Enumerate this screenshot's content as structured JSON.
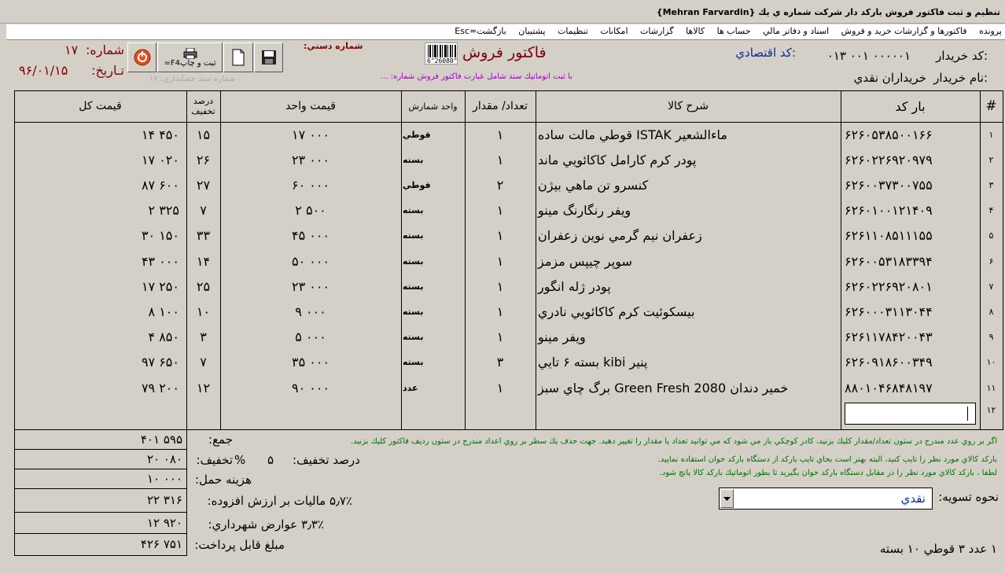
{
  "window": {
    "title": "تنظيم و ثبت فاكتور فروش باركد دار شركت شماره ي يك   {Mehran Farvardin}"
  },
  "menu": [
    "پرونده",
    "فاكتورها و گزارشات خريد و فروش",
    "اسناد و دفاتر مالي",
    "حساب ها",
    "كالاها",
    "گزارشات",
    "امكانات",
    "تنظيمات",
    "پشتيبان",
    "بازگشت=Esc"
  ],
  "header": {
    "buyer_code_label": "كد خريدار:",
    "buyer_code_value": "۰۱۳  ۰۰۱  ۰۰۰۰۰۱",
    "economic_code_label": "كد اقتصادي:",
    "buyer_name_label": "نام خريدار:",
    "buyer_name_value": "خريداران نقدي",
    "invoice_title": "فاكتور فروش",
    "barcode_digits": "6\"26080\"",
    "auto_note": "با ثبت اتوماتيك سند شامل عبارت فاكتور فروش شماره: ...",
    "manual_no_label": "شماره دستي:",
    "number_label": "شماره:",
    "number_value": "۱۷",
    "date_label": "تـاريخ:",
    "date_value": "۹۶/۰۱/۱۵",
    "doc_no_label": "شماره سند حسابداري: ۱۷"
  },
  "toolbar": {
    "print_label_1": "ثبت و چاپ",
    "print_label_2": "F4="
  },
  "icons": {
    "save": "floppy-disk-icon",
    "new": "new-document-icon",
    "print": "printer-icon",
    "exit": "power-icon"
  },
  "columns": {
    "idx": "#",
    "barcode": "بار كد",
    "desc": "شرح كالا",
    "qty": "تعداد/ مقدار",
    "unit": "واحد شمارش",
    "unit_price": "قيمت واحد",
    "disc_1": "درصد",
    "disc_2": "تخفيف",
    "total": "قيمت كل"
  },
  "rows": [
    {
      "n": "۱",
      "barcode": "۶۲۶۰۵۳۸۵۰۰۱۶۶",
      "desc": "ماءالشعير ISTAK قوطي مالت ساده",
      "qty": "۱",
      "unit": "قوطي",
      "price": "۱۷ ۰۰۰",
      "disc": "۱۵",
      "total": "۱۴ ۴۵۰"
    },
    {
      "n": "۲",
      "barcode": "۶۲۶۰۲۲۶۹۲۰۹۷۹",
      "desc": "پودر كرم كارامل كاكائويي ماند",
      "qty": "۱",
      "unit": "بسته",
      "price": "۲۳ ۰۰۰",
      "disc": "۲۶",
      "total": "۱۷ ۰۲۰"
    },
    {
      "n": "۳",
      "barcode": "۶۲۶۰۰۳۷۳۰۰۷۵۵",
      "desc": "كنسرو تن ماهي بيژن",
      "qty": "۲",
      "unit": "قوطي",
      "price": "۶۰ ۰۰۰",
      "disc": "۲۷",
      "total": "۸۷ ۶۰۰"
    },
    {
      "n": "۴",
      "barcode": "۶۲۶۰۱۰۰۱۲۱۴۰۹",
      "desc": "ويفر رنگارنگ مينو",
      "qty": "۱",
      "unit": "بسته",
      "price": "۲ ۵۰۰",
      "disc": "۷",
      "total": "۲ ۳۲۵"
    },
    {
      "n": "۵",
      "barcode": "۶۲۶۱۱۰۸۵۱۱۱۵۵",
      "desc": "زعفران نيم گرمي نوين زعفران",
      "qty": "۱",
      "unit": "بسته",
      "price": "۴۵ ۰۰۰",
      "disc": "۳۳",
      "total": "۳۰ ۱۵۰"
    },
    {
      "n": "۶",
      "barcode": "۶۲۶۰۰۵۳۱۸۳۳۹۴",
      "desc": "سوپر چيپس مزمز",
      "qty": "۱",
      "unit": "بسته",
      "price": "۵۰ ۰۰۰",
      "disc": "۱۴",
      "total": "۴۳ ۰۰۰"
    },
    {
      "n": "۷",
      "barcode": "۶۲۶۰۲۲۶۹۲۰۸۰۱",
      "desc": "پودر ژله انگور",
      "qty": "۱",
      "unit": "بسته",
      "price": "۲۳ ۰۰۰",
      "disc": "۲۵",
      "total": "۱۷ ۲۵۰"
    },
    {
      "n": "۸",
      "barcode": "۶۲۶۰۰۰۳۱۱۳۰۴۴",
      "desc": "بيسكوئيت كرم كاكائويي نادري",
      "qty": "۱",
      "unit": "بسته",
      "price": "۹ ۰۰۰",
      "disc": "۱۰",
      "total": "۸ ۱۰۰"
    },
    {
      "n": "۹",
      "barcode": "۶۲۶۱۱۷۸۴۲۰۰۴۳",
      "desc": "ويفر مينو",
      "qty": "۱",
      "unit": "بسته",
      "price": "۵ ۰۰۰",
      "disc": "۳",
      "total": "۴ ۸۵۰"
    },
    {
      "n": "۱۰",
      "barcode": "۶۲۶۰۹۱۸۶۰۰۳۴۹",
      "desc": "پنير kibi بسته ۶ تايي",
      "qty": "۳",
      "unit": "بسته",
      "price": "۳۵ ۰۰۰",
      "disc": "۷",
      "total": "۹۷ ۶۵۰"
    },
    {
      "n": "۱۱",
      "barcode": "۸۸۰۱۰۴۶۸۴۸۱۹۷",
      "desc": "خمير دندان Green Fresh 2080 برگ چاي سبز",
      "qty": "۱",
      "unit": "عدد",
      "price": "۹۰ ۰۰۰",
      "disc": "۱۲",
      "total": "۷۹ ۲۰۰"
    }
  ],
  "new_row_index": "۱۲",
  "totals": {
    "sum_label": "جمع:",
    "sum_value": "۴۰۱ ۵۹۵",
    "disc_label": "تخفيف:",
    "disc_value": "۲۰ ۰۸۰",
    "disc_percent_label": "درصد تخفيف:",
    "disc_percent_value": "۵",
    "disc_percent_sign": "%",
    "shipping_label": "هزينه حمل:",
    "shipping_value": "۱۰ ۰۰۰",
    "vat_label": "۵٫۷٪ ماليات بر ارزش افزوده:",
    "vat_value": "۲۲ ۳۱۶",
    "muni_label": "۳٫۳٪ عوارض شهرداري:",
    "muni_value": "۱۲ ۹۲۰",
    "payable_label": "مبلغ قابل پرداخت:",
    "payable_value": "۴۲۶ ۷۵۱"
  },
  "notes": {
    "note1": "اگر بر روي عدد مندرج در ستون تعداد/مقدار كليك بزنيد، كادر كوچكي باز مي شود كه مي توانيد تعداد يا مقدار  را تغيير دهيد. جهت حذف يك سطر بر روي اعداد مندرج در ستون رديف فاكتور كليك بزنيد.",
    "note2": "باركد كالاي مورد نظر  را  تايپ  كنيد، البته بهتر است بجاي تايپ باركد از دستگاه باركد خوان استفاده نماييد.",
    "note3": "لطفا ، باركد كالاي مورد نظر را در مقابل دستگاه باركد خوان بگيريد تا بطور اتوماتيك باركد كالا پانچ شود."
  },
  "settlement": {
    "label": "نحوه تسويه:",
    "value": "نقدي"
  },
  "summary": "۱ عدد  ۳ قوطي  ۱۰ بسته",
  "colors": {
    "background": "#d4d0c8",
    "blue": "#0a2d9a",
    "purple": "#a000c0",
    "green": "#007000"
  }
}
